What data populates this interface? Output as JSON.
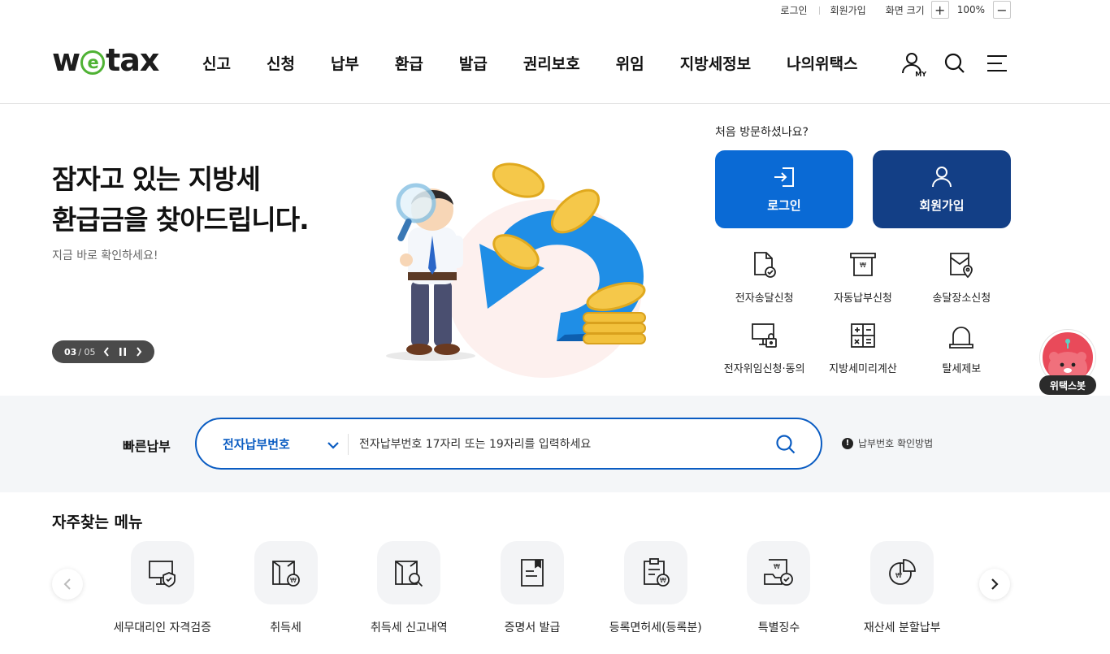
{
  "utility": {
    "login": "로그인",
    "signup": "회원가입",
    "zoom_label": "화면 크기",
    "zoom_in": "+",
    "zoom_value": "100%",
    "zoom_out": "−"
  },
  "header": {
    "logo_w": "w",
    "logo_e": "e",
    "logo_tax": "tax",
    "nav": [
      "신고",
      "신청",
      "납부",
      "환급",
      "발급",
      "권리보호",
      "위임",
      "지방세정보",
      "나의위택스"
    ],
    "my_label": "MY"
  },
  "hero": {
    "title_line1": "잠자고 있는 지방세",
    "title_line2": "환급금을 찾아드립니다.",
    "subtitle": "지금 바로 확인하세요!",
    "slide_current": "03",
    "slide_separator": "/",
    "slide_total": "05"
  },
  "member": {
    "first_visit": "처음 방문하셨나요?",
    "login_label": "로그인",
    "signup_label": "회원가입"
  },
  "services": [
    {
      "label": "전자송달신청",
      "icon": "document-check-icon"
    },
    {
      "label": "자동납부신청",
      "icon": "auto-pay-icon"
    },
    {
      "label": "송달장소신청",
      "icon": "location-document-icon"
    },
    {
      "label": "전자위임신청·동의",
      "icon": "monitor-lock-icon"
    },
    {
      "label": "지방세미리계산",
      "icon": "calculator-icon"
    },
    {
      "label": "탈세제보",
      "icon": "siren-icon"
    }
  ],
  "chatbot": {
    "label": "위택스봇"
  },
  "quickpay": {
    "label": "빠른납부",
    "select_value": "전자납부번호",
    "placeholder": "전자납부번호 17자리 또는 19자리를 입력하세요",
    "help": "납부번호 확인방법"
  },
  "frequent": {
    "title": "자주찾는 메뉴",
    "items": [
      {
        "label": "세무대리인 자격검증",
        "icon": "monitor-shield-icon"
      },
      {
        "label": "취득세",
        "icon": "building-won-icon"
      },
      {
        "label": "취득세 신고내역",
        "icon": "building-search-icon"
      },
      {
        "label": "증명서 발급",
        "icon": "certificate-icon"
      },
      {
        "label": "등록면허세(등록분)",
        "icon": "clipboard-won-icon"
      },
      {
        "label": "특별징수",
        "icon": "tray-check-icon"
      },
      {
        "label": "재산세 분할납부",
        "icon": "pie-chart-won-icon"
      }
    ]
  },
  "colors": {
    "primary_blue": "#0a6ad5",
    "navy": "#133f86",
    "logo_green": "#4fb234",
    "chatbot_red": "#e94a5a"
  }
}
